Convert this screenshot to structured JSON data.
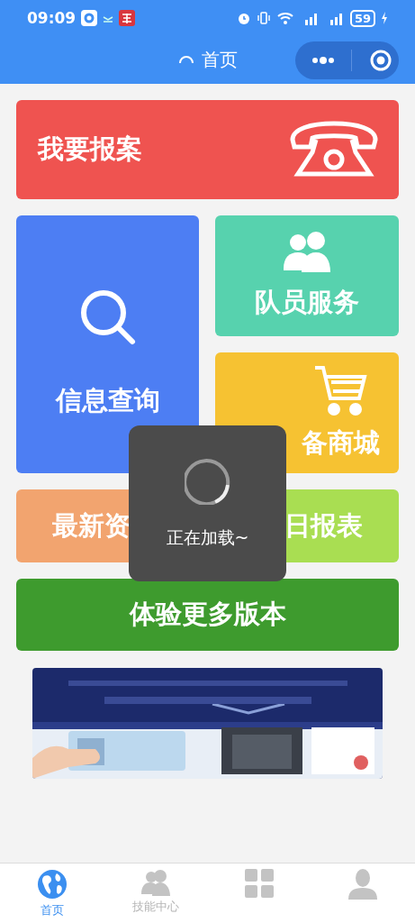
{
  "status_bar": {
    "time": "09:09",
    "battery": "59"
  },
  "nav": {
    "title": "首页",
    "loading": true
  },
  "tiles": [
    {
      "label": "我要报案",
      "kind": "phone",
      "color": "#ef5350"
    },
    {
      "label": "信息查询",
      "kind": "search",
      "color": "#4d7ef3"
    },
    {
      "label": "队员服务",
      "kind": "people",
      "color": "#57d2ae"
    },
    {
      "label": "备商城",
      "kind": "cart",
      "color": "#f6c232"
    },
    {
      "label": "最新资",
      "kind": "text",
      "color": "#f2a46f"
    },
    {
      "label": "日报表",
      "kind": "text",
      "color": "#a9de52"
    },
    {
      "label": "体验更多版本",
      "kind": "text",
      "color": "#3e9b2e"
    }
  ],
  "loading_toast": {
    "text": "正在加载~"
  },
  "tabs": [
    {
      "label": "首页",
      "kind": "globe",
      "selected": true
    },
    {
      "label": "技能中心",
      "kind": "people",
      "selected": false
    },
    {
      "kind": "grid",
      "selected": false
    },
    {
      "kind": "person",
      "selected": false
    }
  ]
}
